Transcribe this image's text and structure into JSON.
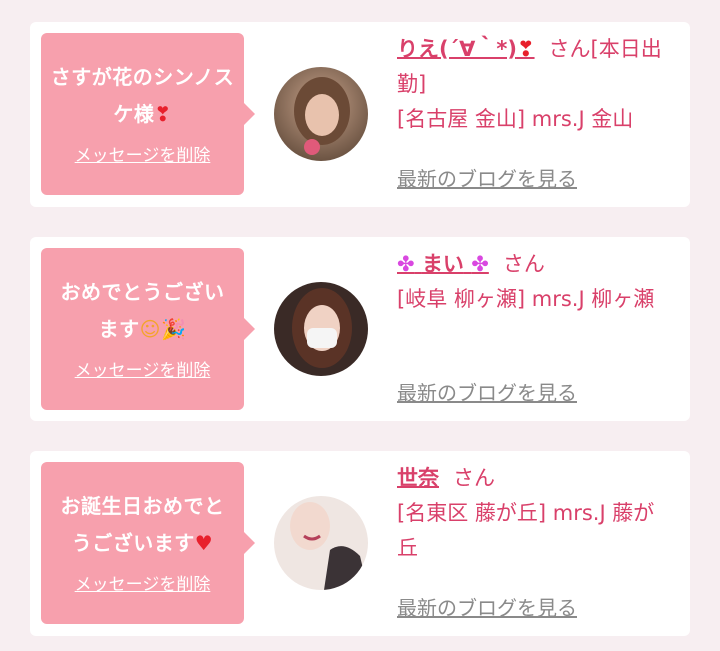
{
  "messages": [
    {
      "text": "さすが花のシンノスケ様",
      "text_emoji": "❣",
      "delete_label": "メッセージを削除",
      "name": "りえ(´∀｀*)",
      "name_emoji": "❣",
      "honorific": "さん",
      "shop_status": "[本日出勤]",
      "location": "[名古屋 金山] mrs.J 金山",
      "blog_label": "最新のブログを見る"
    },
    {
      "text": "おめでとうございます",
      "text_emoji_1": "☺",
      "text_emoji_2": "🎉",
      "delete_label": "メッセージを削除",
      "name_prefix_icon": "✤",
      "name": "まい",
      "name_suffix_icon": "✤",
      "honorific": "さん",
      "location": "[岐阜 柳ヶ瀬] mrs.J 柳ヶ瀬",
      "blog_label": "最新のブログを見る"
    },
    {
      "text": "お誕生日おめでとうございます",
      "text_emoji": "♥",
      "delete_label": "メッセージを削除",
      "name": "世奈",
      "honorific": "さん",
      "location": "[名東区 藤が丘] mrs.J 藤が丘",
      "blog_label": "最新のブログを見る"
    }
  ],
  "colors": {
    "bubble": "#f7a0ad",
    "accent": "#d9406a",
    "link_gray": "#8a8a8a",
    "background": "#f7eef1"
  }
}
